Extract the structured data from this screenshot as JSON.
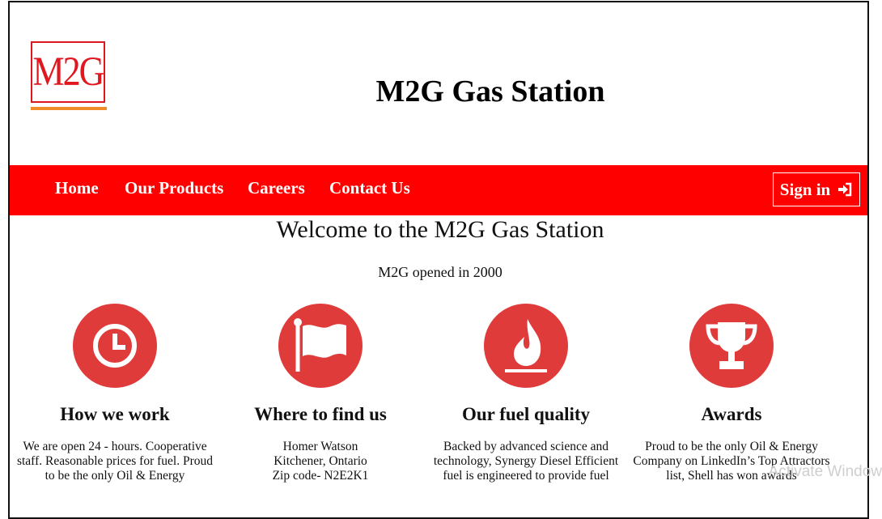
{
  "logo": {
    "text": "M2G"
  },
  "header": {
    "title": "M2G Gas Station"
  },
  "nav": {
    "items": [
      {
        "label": "Home"
      },
      {
        "label": "Our Products"
      },
      {
        "label": "Careers"
      },
      {
        "label": "Contact Us"
      }
    ],
    "signin_label": "Sign in"
  },
  "main": {
    "welcome": "Welcome to the M2G Gas Station",
    "opened": "M2G opened in 2000"
  },
  "features": [
    {
      "icon": "clock-icon",
      "title": "How we work",
      "text": "We are open 24 - hours. Cooperative staff. Reasonable prices for fuel. Proud to be the only Oil & Energy"
    },
    {
      "icon": "flag-icon",
      "title": "Where to find us",
      "lines": [
        "Homer Watson",
        "Kitchener, Ontario",
        "Zip code- N2E2K1"
      ]
    },
    {
      "icon": "fire-icon",
      "title": "Our fuel quality",
      "text": "Backed by advanced science and technology, Synergy Diesel Efficient fuel is engineered to provide fuel"
    },
    {
      "icon": "trophy-icon",
      "title": "Awards",
      "text": "Proud to be the only Oil & Energy Company on LinkedIn’s Top Attractors list, Shell has won awards"
    }
  ],
  "watermark": "Activate Window",
  "colors": {
    "nav_bg": "#ff0000",
    "icon_bg": "#e03b3b",
    "logo_red": "#e0171f",
    "logo_bar": "#f08c2a"
  }
}
